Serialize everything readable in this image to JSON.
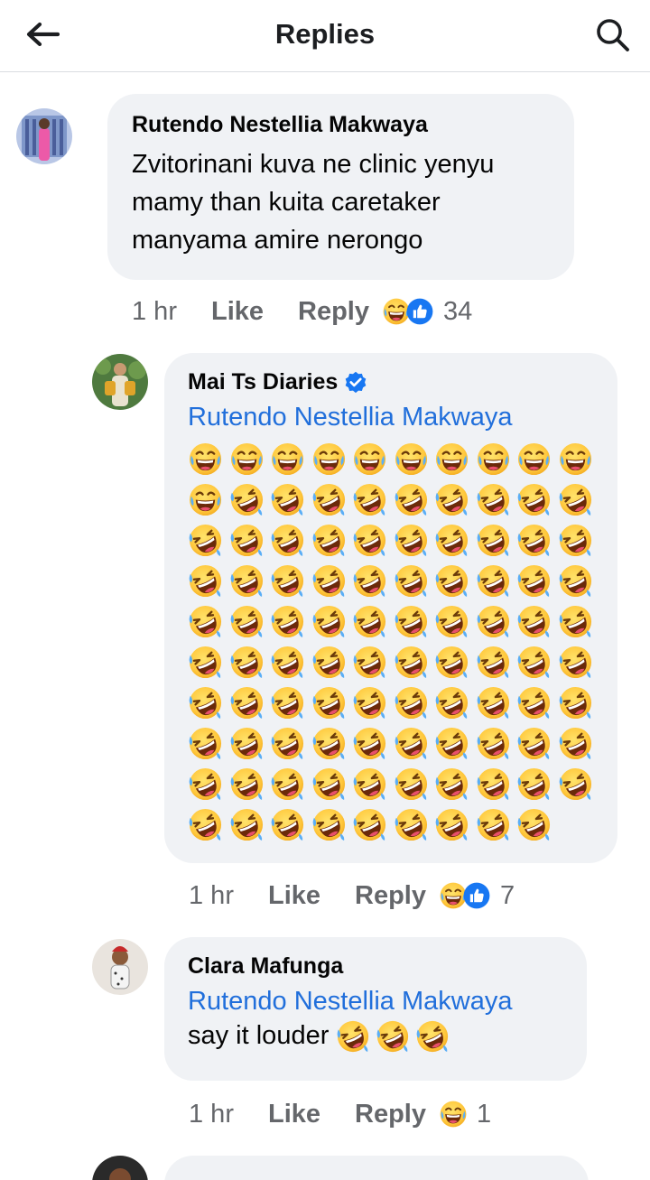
{
  "header": {
    "title": "Replies"
  },
  "comments": [
    {
      "author": "Rutendo Nestellia Makwaya",
      "lines": [
        "Zvitorinani kuva ne clinic yenyu",
        "mamy than kuita caretaker",
        "manyama amire nerongo"
      ],
      "time": "1 hr",
      "like_label": "Like",
      "reply_label": "Reply",
      "reactions": [
        "haha",
        "like"
      ],
      "reaction_count": "34"
    },
    {
      "author": "Mai Ts Diaries",
      "verified": true,
      "mention": "Rutendo Nestellia Makwaya",
      "emoji_rows": [
        [
          "grin-sweat",
          "grin-sweat",
          "grin-sweat",
          "grin-sweat",
          "grin-sweat",
          "grin-sweat",
          "grin-sweat",
          "grin-sweat",
          "grin-sweat",
          "grin-sweat"
        ],
        [
          "grin-sweat",
          "rofl",
          "rofl",
          "rofl",
          "rofl",
          "rofl",
          "rofl",
          "rofl",
          "rofl",
          "rofl"
        ],
        [
          "rofl",
          "rofl",
          "rofl",
          "rofl",
          "rofl",
          "rofl",
          "rofl",
          "rofl",
          "rofl",
          "rofl"
        ],
        [
          "rofl",
          "rofl",
          "rofl",
          "rofl",
          "rofl",
          "rofl",
          "rofl",
          "rofl",
          "rofl",
          "rofl"
        ],
        [
          "rofl",
          "rofl",
          "rofl",
          "rofl",
          "rofl",
          "rofl",
          "rofl",
          "rofl",
          "rofl",
          "rofl"
        ],
        [
          "rofl",
          "rofl",
          "rofl",
          "rofl",
          "rofl",
          "rofl",
          "rofl",
          "rofl",
          "rofl",
          "rofl"
        ],
        [
          "rofl",
          "rofl",
          "rofl",
          "rofl",
          "rofl",
          "rofl",
          "rofl",
          "rofl",
          "rofl",
          "rofl"
        ],
        [
          "rofl",
          "rofl",
          "rofl",
          "rofl",
          "rofl",
          "rofl",
          "rofl",
          "rofl",
          "rofl",
          "rofl"
        ],
        [
          "rofl",
          "rofl",
          "rofl",
          "rofl",
          "rofl",
          "rofl",
          "rofl",
          "rofl",
          "rofl",
          "rofl"
        ],
        [
          "rofl",
          "rofl",
          "rofl",
          "rofl",
          "rofl",
          "rofl",
          "rofl",
          "rofl",
          "rofl"
        ]
      ],
      "time": "1 hr",
      "like_label": "Like",
      "reply_label": "Reply",
      "reactions": [
        "haha",
        "like"
      ],
      "reaction_count": "7"
    },
    {
      "author": "Clara Mafunga",
      "mention": "Rutendo Nestellia Makwaya",
      "text": "say it louder",
      "trailing_emojis": [
        "rofl",
        "rofl",
        "rofl"
      ],
      "time": "1 hr",
      "like_label": "Like",
      "reply_label": "Reply",
      "reactions": [
        "haha"
      ],
      "reaction_count": "1"
    }
  ],
  "colors": {
    "bubble": "#f0f2f5",
    "mention": "#216fdb",
    "meta": "#65676b",
    "verified": "#1877f2",
    "like_reaction": "#1877f2",
    "emoji_face": "#ffc83d"
  }
}
